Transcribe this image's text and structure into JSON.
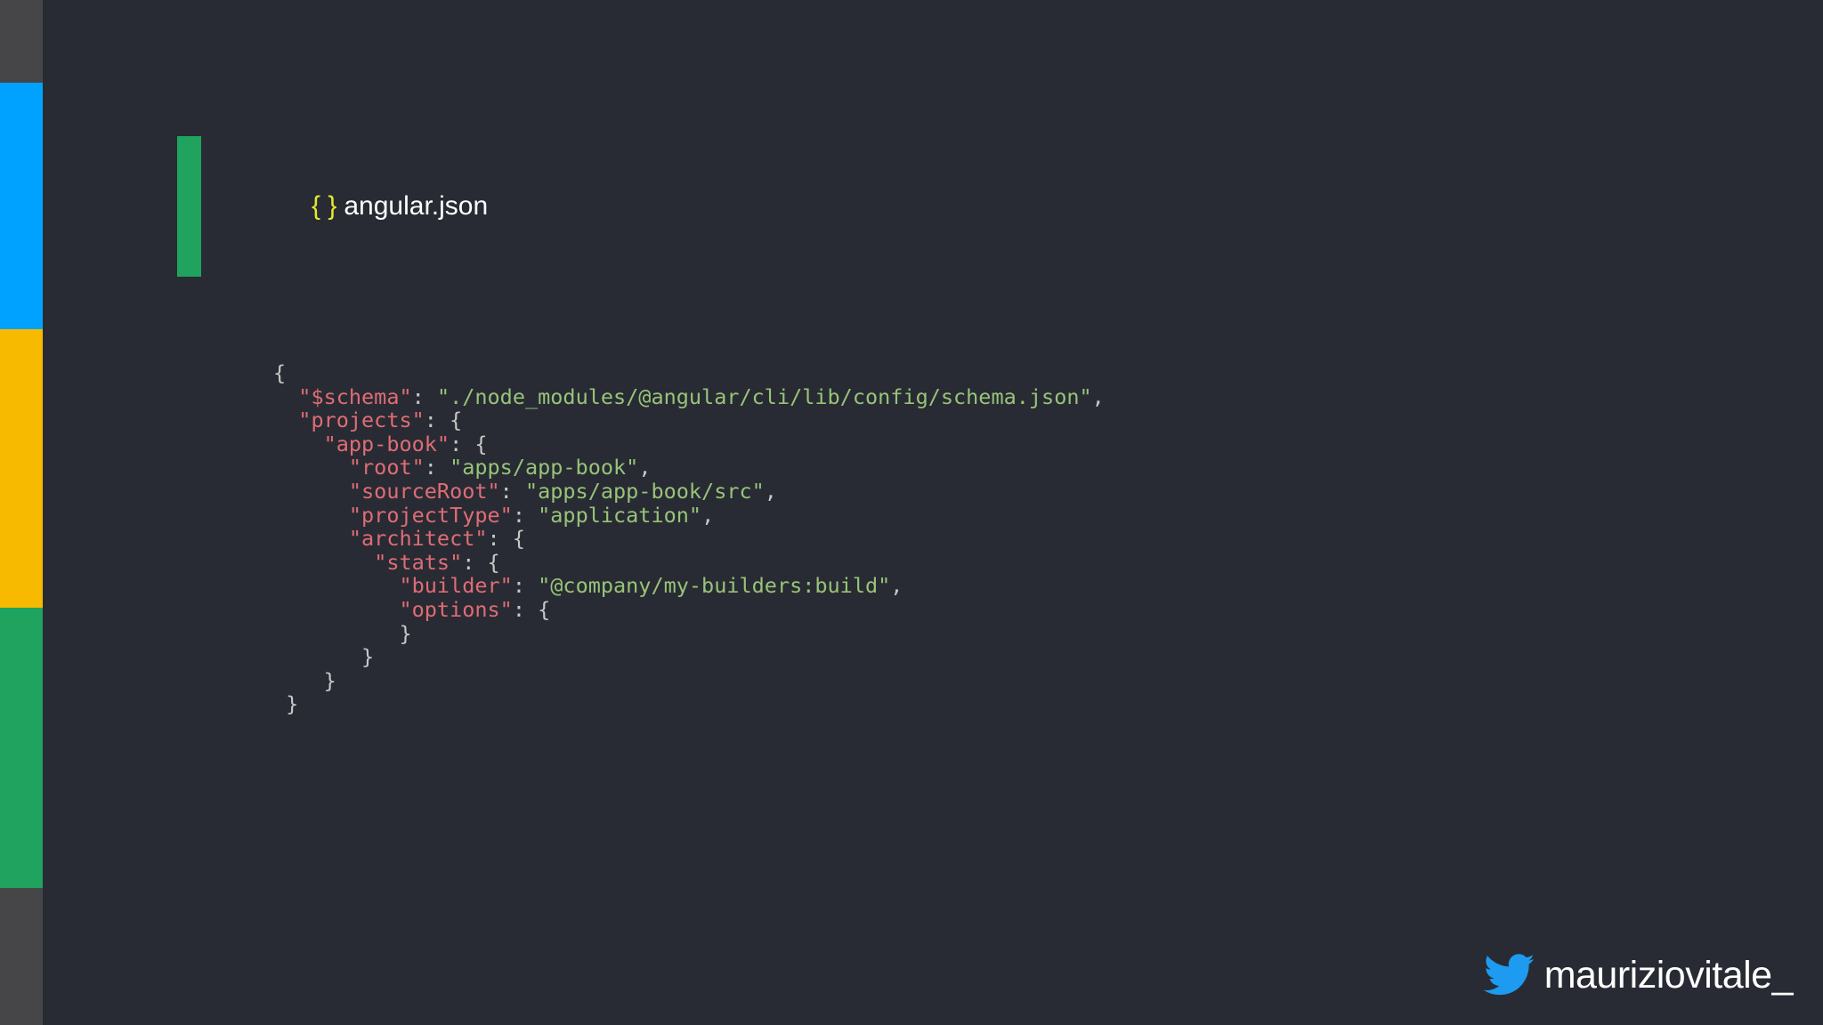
{
  "colors": {
    "background": "#282b33",
    "stripes": [
      "#464648",
      "#00a2ff",
      "#f8ba00",
      "#1fa35f",
      "#464648"
    ],
    "accent_bar": "#1fa35f",
    "braces": "#e6e82a",
    "key": "#e06c75",
    "string": "#98c379",
    "punct": "#c5c8c6",
    "twitter": "#1d9bf0"
  },
  "title": {
    "braces": "{ }",
    "filename": "angular.json"
  },
  "code": {
    "lines": [
      {
        "indent": "",
        "segments": [
          {
            "t": "punct",
            "v": "{"
          }
        ]
      },
      {
        "indent": "  ",
        "segments": [
          {
            "t": "key",
            "v": "\"$schema\""
          },
          {
            "t": "punct",
            "v": ": "
          },
          {
            "t": "str",
            "v": "\"./node_modules/@angular/cli/lib/config/schema.json\""
          },
          {
            "t": "punct",
            "v": ","
          }
        ]
      },
      {
        "indent": "  ",
        "segments": [
          {
            "t": "key",
            "v": "\"projects\""
          },
          {
            "t": "punct",
            "v": ": {"
          }
        ]
      },
      {
        "indent": "    ",
        "segments": [
          {
            "t": "key",
            "v": "\"app-book\""
          },
          {
            "t": "punct",
            "v": ": {"
          }
        ]
      },
      {
        "indent": "      ",
        "segments": [
          {
            "t": "key",
            "v": "\"root\""
          },
          {
            "t": "punct",
            "v": ": "
          },
          {
            "t": "str",
            "v": "\"apps/app-book\""
          },
          {
            "t": "punct",
            "v": ","
          }
        ]
      },
      {
        "indent": "      ",
        "segments": [
          {
            "t": "key",
            "v": "\"sourceRoot\""
          },
          {
            "t": "punct",
            "v": ": "
          },
          {
            "t": "str",
            "v": "\"apps/app-book/src\""
          },
          {
            "t": "punct",
            "v": ","
          }
        ]
      },
      {
        "indent": "      ",
        "segments": [
          {
            "t": "key",
            "v": "\"projectType\""
          },
          {
            "t": "punct",
            "v": ": "
          },
          {
            "t": "str",
            "v": "\"application\""
          },
          {
            "t": "punct",
            "v": ","
          }
        ]
      },
      {
        "indent": "      ",
        "segments": [
          {
            "t": "key",
            "v": "\"architect\""
          },
          {
            "t": "punct",
            "v": ": {"
          }
        ]
      },
      {
        "indent": "        ",
        "segments": [
          {
            "t": "key",
            "v": "\"stats\""
          },
          {
            "t": "punct",
            "v": ": {"
          }
        ]
      },
      {
        "indent": "          ",
        "segments": [
          {
            "t": "key",
            "v": "\"builder\""
          },
          {
            "t": "punct",
            "v": ": "
          },
          {
            "t": "str",
            "v": "\"@company/my-builders:build\""
          },
          {
            "t": "punct",
            "v": ","
          }
        ]
      },
      {
        "indent": "          ",
        "segments": [
          {
            "t": "key",
            "v": "\"options\""
          },
          {
            "t": "punct",
            "v": ": {"
          }
        ]
      },
      {
        "indent": "          ",
        "segments": [
          {
            "t": "punct",
            "v": "}"
          }
        ]
      },
      {
        "indent": "       ",
        "segments": [
          {
            "t": "punct",
            "v": "}"
          }
        ]
      },
      {
        "indent": "    ",
        "segments": [
          {
            "t": "punct",
            "v": "}"
          }
        ]
      },
      {
        "indent": " ",
        "segments": [
          {
            "t": "punct",
            "v": "}"
          }
        ]
      }
    ]
  },
  "footer": {
    "icon": "twitter-bird-icon",
    "handle": "mauriziovitale_"
  }
}
